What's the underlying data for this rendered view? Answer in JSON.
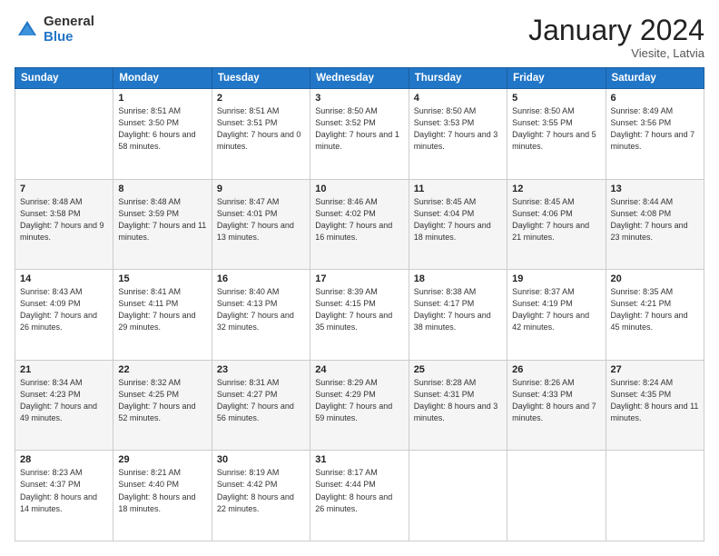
{
  "logo": {
    "general": "General",
    "blue": "Blue"
  },
  "header": {
    "month": "January 2024",
    "location": "Viesite, Latvia"
  },
  "weekdays": [
    "Sunday",
    "Monday",
    "Tuesday",
    "Wednesday",
    "Thursday",
    "Friday",
    "Saturday"
  ],
  "weeks": [
    [
      {
        "day": "",
        "info": ""
      },
      {
        "day": "1",
        "info": "Sunrise: 8:51 AM\nSunset: 3:50 PM\nDaylight: 6 hours\nand 58 minutes."
      },
      {
        "day": "2",
        "info": "Sunrise: 8:51 AM\nSunset: 3:51 PM\nDaylight: 7 hours\nand 0 minutes."
      },
      {
        "day": "3",
        "info": "Sunrise: 8:50 AM\nSunset: 3:52 PM\nDaylight: 7 hours\nand 1 minute."
      },
      {
        "day": "4",
        "info": "Sunrise: 8:50 AM\nSunset: 3:53 PM\nDaylight: 7 hours\nand 3 minutes."
      },
      {
        "day": "5",
        "info": "Sunrise: 8:50 AM\nSunset: 3:55 PM\nDaylight: 7 hours\nand 5 minutes."
      },
      {
        "day": "6",
        "info": "Sunrise: 8:49 AM\nSunset: 3:56 PM\nDaylight: 7 hours\nand 7 minutes."
      }
    ],
    [
      {
        "day": "7",
        "info": "Sunrise: 8:48 AM\nSunset: 3:58 PM\nDaylight: 7 hours\nand 9 minutes."
      },
      {
        "day": "8",
        "info": "Sunrise: 8:48 AM\nSunset: 3:59 PM\nDaylight: 7 hours\nand 11 minutes."
      },
      {
        "day": "9",
        "info": "Sunrise: 8:47 AM\nSunset: 4:01 PM\nDaylight: 7 hours\nand 13 minutes."
      },
      {
        "day": "10",
        "info": "Sunrise: 8:46 AM\nSunset: 4:02 PM\nDaylight: 7 hours\nand 16 minutes."
      },
      {
        "day": "11",
        "info": "Sunrise: 8:45 AM\nSunset: 4:04 PM\nDaylight: 7 hours\nand 18 minutes."
      },
      {
        "day": "12",
        "info": "Sunrise: 8:45 AM\nSunset: 4:06 PM\nDaylight: 7 hours\nand 21 minutes."
      },
      {
        "day": "13",
        "info": "Sunrise: 8:44 AM\nSunset: 4:08 PM\nDaylight: 7 hours\nand 23 minutes."
      }
    ],
    [
      {
        "day": "14",
        "info": "Sunrise: 8:43 AM\nSunset: 4:09 PM\nDaylight: 7 hours\nand 26 minutes."
      },
      {
        "day": "15",
        "info": "Sunrise: 8:41 AM\nSunset: 4:11 PM\nDaylight: 7 hours\nand 29 minutes."
      },
      {
        "day": "16",
        "info": "Sunrise: 8:40 AM\nSunset: 4:13 PM\nDaylight: 7 hours\nand 32 minutes."
      },
      {
        "day": "17",
        "info": "Sunrise: 8:39 AM\nSunset: 4:15 PM\nDaylight: 7 hours\nand 35 minutes."
      },
      {
        "day": "18",
        "info": "Sunrise: 8:38 AM\nSunset: 4:17 PM\nDaylight: 7 hours\nand 38 minutes."
      },
      {
        "day": "19",
        "info": "Sunrise: 8:37 AM\nSunset: 4:19 PM\nDaylight: 7 hours\nand 42 minutes."
      },
      {
        "day": "20",
        "info": "Sunrise: 8:35 AM\nSunset: 4:21 PM\nDaylight: 7 hours\nand 45 minutes."
      }
    ],
    [
      {
        "day": "21",
        "info": "Sunrise: 8:34 AM\nSunset: 4:23 PM\nDaylight: 7 hours\nand 49 minutes."
      },
      {
        "day": "22",
        "info": "Sunrise: 8:32 AM\nSunset: 4:25 PM\nDaylight: 7 hours\nand 52 minutes."
      },
      {
        "day": "23",
        "info": "Sunrise: 8:31 AM\nSunset: 4:27 PM\nDaylight: 7 hours\nand 56 minutes."
      },
      {
        "day": "24",
        "info": "Sunrise: 8:29 AM\nSunset: 4:29 PM\nDaylight: 7 hours\nand 59 minutes."
      },
      {
        "day": "25",
        "info": "Sunrise: 8:28 AM\nSunset: 4:31 PM\nDaylight: 8 hours\nand 3 minutes."
      },
      {
        "day": "26",
        "info": "Sunrise: 8:26 AM\nSunset: 4:33 PM\nDaylight: 8 hours\nand 7 minutes."
      },
      {
        "day": "27",
        "info": "Sunrise: 8:24 AM\nSunset: 4:35 PM\nDaylight: 8 hours\nand 11 minutes."
      }
    ],
    [
      {
        "day": "28",
        "info": "Sunrise: 8:23 AM\nSunset: 4:37 PM\nDaylight: 8 hours\nand 14 minutes."
      },
      {
        "day": "29",
        "info": "Sunrise: 8:21 AM\nSunset: 4:40 PM\nDaylight: 8 hours\nand 18 minutes."
      },
      {
        "day": "30",
        "info": "Sunrise: 8:19 AM\nSunset: 4:42 PM\nDaylight: 8 hours\nand 22 minutes."
      },
      {
        "day": "31",
        "info": "Sunrise: 8:17 AM\nSunset: 4:44 PM\nDaylight: 8 hours\nand 26 minutes."
      },
      {
        "day": "",
        "info": ""
      },
      {
        "day": "",
        "info": ""
      },
      {
        "day": "",
        "info": ""
      }
    ]
  ]
}
